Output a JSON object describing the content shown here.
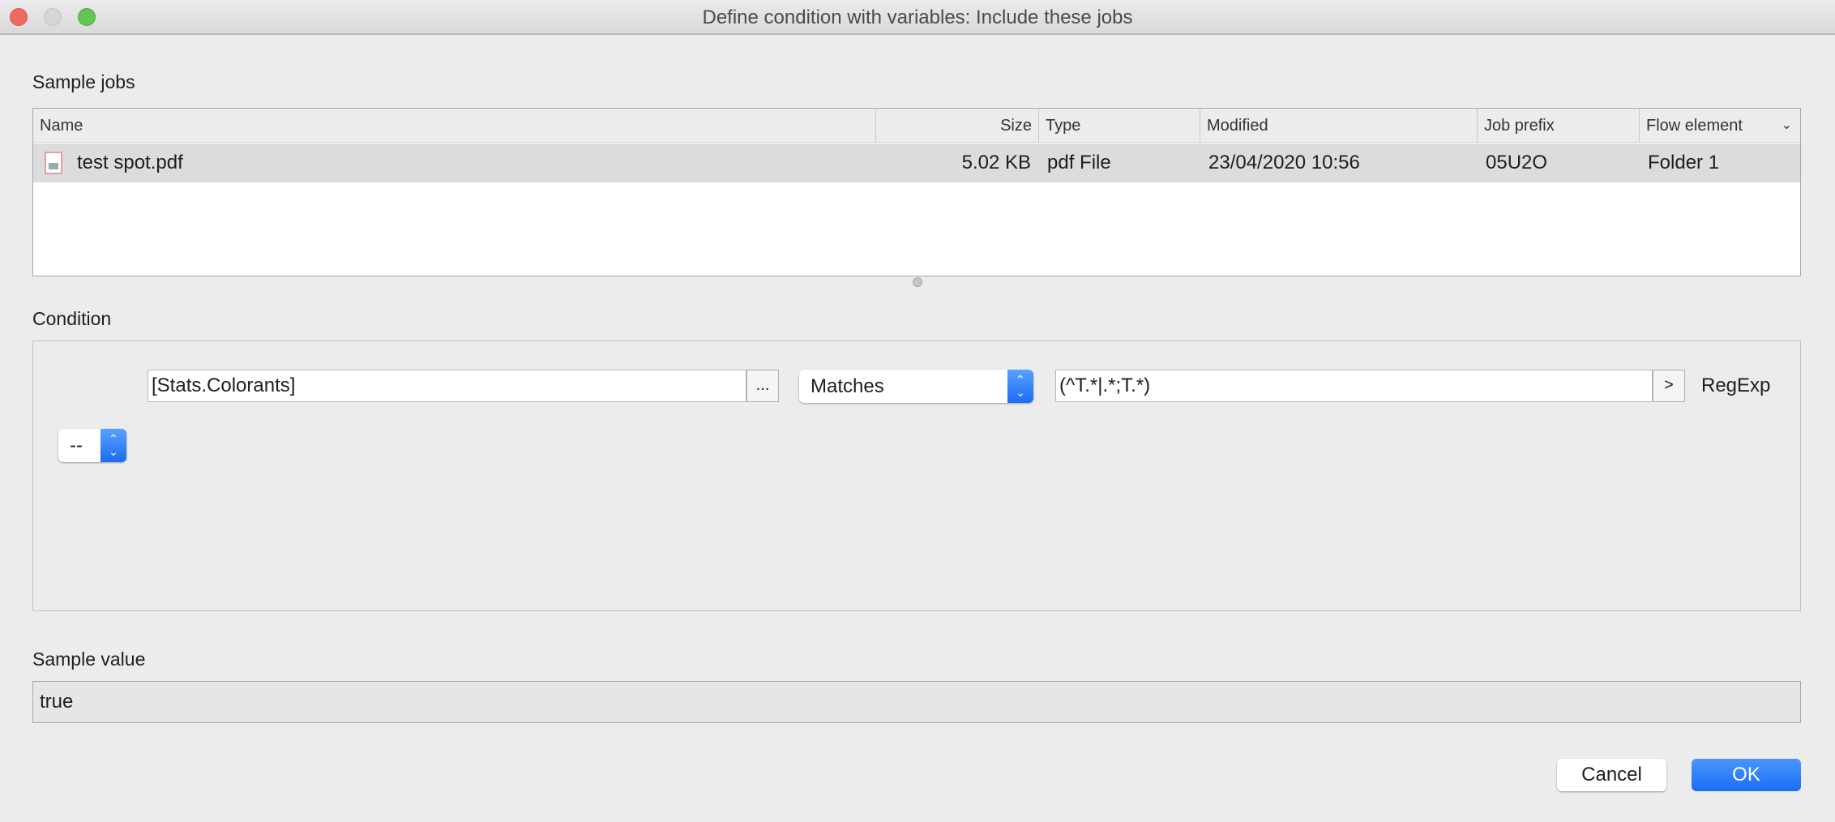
{
  "window": {
    "title": "Define condition with variables: Include these jobs"
  },
  "sample_jobs": {
    "label": "Sample jobs",
    "columns": [
      "Name",
      "Size",
      "Type",
      "Modified",
      "Job prefix",
      "Flow element"
    ],
    "rows": [
      {
        "icon": "pdf-file-icon",
        "name": "test spot.pdf",
        "size": "5.02 KB",
        "type": "pdf File",
        "modified": "23/04/2020 10:56",
        "job_prefix": "05U2O",
        "flow_element": "Folder 1"
      }
    ]
  },
  "condition": {
    "label": "Condition",
    "variable": "[Stats.Colorants]",
    "browse_label": "...",
    "operator": "Matches",
    "value": "(^T.*|.*;T.*)",
    "insert_label": ">",
    "value_type": "RegExp",
    "logic_operator": "--"
  },
  "sample_value": {
    "label": "Sample value",
    "value": "true"
  },
  "buttons": {
    "cancel": "Cancel",
    "ok": "OK"
  },
  "colors": {
    "accent": "#1a73f5",
    "close": "#ee6a5f",
    "minimize": "#d6d6d6",
    "zoom": "#62c554"
  }
}
